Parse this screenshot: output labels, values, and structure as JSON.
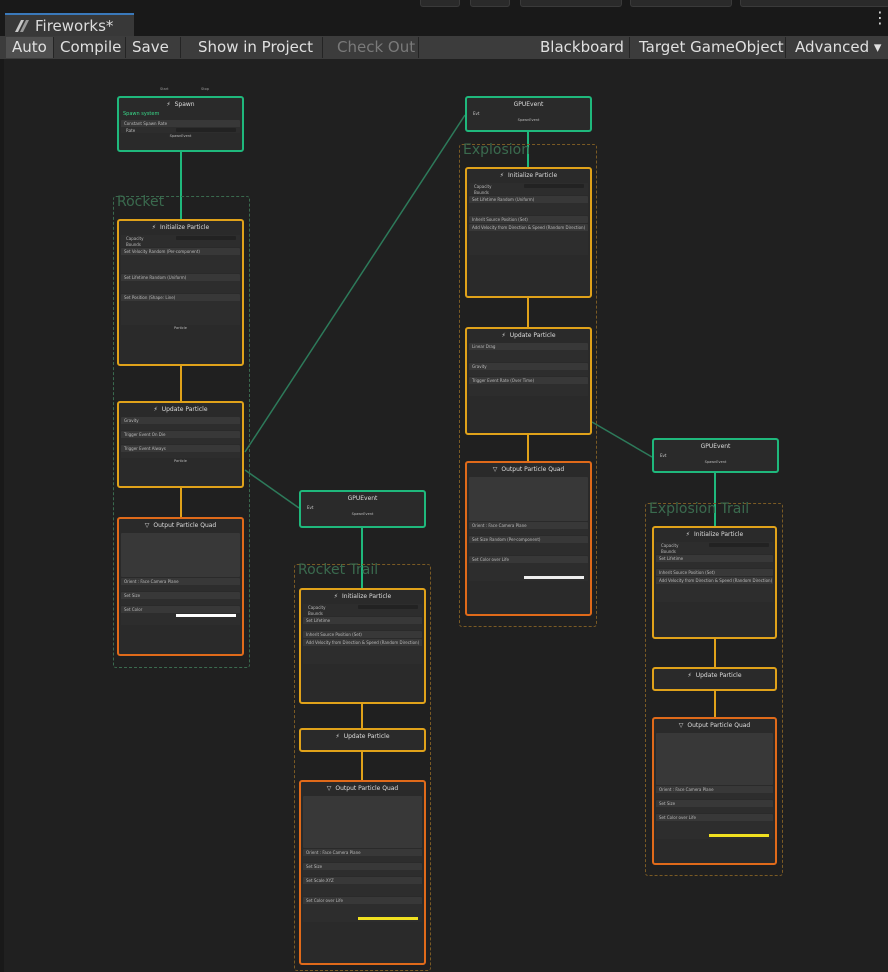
{
  "window": {
    "tab_title": "Fireworks*",
    "menu_icon": "kebab-menu-icon"
  },
  "toolbar": {
    "auto": "Auto",
    "compile": "Compile",
    "save": "Save",
    "show_in_project": "Show in Project",
    "check_out": "Check Out",
    "blackboard": "Blackboard",
    "target_gameobject": "Target GameObject",
    "advanced": "Advanced",
    "advanced_arrow": "▾"
  },
  "groups": {
    "rocket": "Rocket",
    "explosion": "Explosion",
    "rocket_trail": "Rocket Trail",
    "explosion_trail": "Explosion Trail"
  },
  "spawn": {
    "title": "Spawn",
    "subtitle": "Spawn system",
    "block": "Constant Spawn Rate",
    "field": "Rate",
    "out": "SpawnEvent",
    "ports": [
      "Start",
      "Stop"
    ]
  },
  "rocket": {
    "init_title": "Initialize Particle",
    "init_rows": [
      "Capacity",
      "Bounds",
      "Set Velocity Random (Per-component)",
      "Set Lifetime Random (Uniform)",
      "Set Position (Shape: Line)"
    ],
    "init_out": "Particle",
    "update_title": "Update Particle",
    "update_rows": [
      "Gravity",
      "Trigger Event On Die",
      "Trigger Event Always"
    ],
    "update_out": "Particle",
    "output_title": "Output Particle Quad",
    "output_rows": [
      "Orient : Face Camera Plane",
      "Set Size",
      "Set Color"
    ]
  },
  "gpuevent_nodes": [
    {
      "title": "GPUEvent",
      "in": "Evt",
      "out": "SpawnEvent"
    },
    {
      "title": "GPUEvent",
      "in": "Evt",
      "out": "SpawnEvent"
    },
    {
      "title": "GPUEvent",
      "in": "Evt",
      "out": "SpawnEvent"
    }
  ],
  "explosion": {
    "init_title": "Initialize Particle",
    "init_rows": [
      "Capacity",
      "Bounds",
      "Set Lifetime Random (Uniform)",
      "Inherit Source Position (Set)",
      "Add Velocity from Direction & Speed (Random Direction)"
    ],
    "update_title": "Update Particle",
    "update_rows": [
      "Linear Drag",
      "Gravity",
      "Trigger Event Rate (Over Time)"
    ],
    "output_title": "Output Particle Quad",
    "output_rows": [
      "Orient : Face Camera Plane",
      "Set Size Random (Per-component)",
      "Set Color over Life"
    ]
  },
  "rocket_trail": {
    "init_title": "Initialize Particle",
    "init_rows": [
      "Capacity",
      "Bounds",
      "Set Lifetime",
      "Inherit Source Position (Set)",
      "Add Velocity from Direction & Speed (Random Direction)"
    ],
    "update_title": "Update Particle",
    "update_rows": [],
    "output_title": "Output Particle Quad",
    "output_rows": [
      "Orient : Face Camera Plane",
      "Set Size",
      "Set Scale.XYZ",
      "Set Color over Life"
    ]
  },
  "explosion_trail": {
    "init_title": "Initialize Particle",
    "init_rows": [
      "Capacity",
      "Bounds",
      "Set Lifetime",
      "Inherit Source Position (Set)",
      "Add Velocity from Direction & Speed (Random Direction)"
    ],
    "update_title": "Update Particle",
    "update_rows": [],
    "output_title": "Output Particle Quad",
    "output_rows": [
      "Orient : Face Camera Plane",
      "Set Size",
      "Set Color over Life"
    ]
  },
  "colors": {
    "spawn_border": "#1fb87c",
    "init_border": "#e0a21a",
    "output_border": "#e06a1a",
    "group_rocket": "#3a6a4e",
    "group_explosion": "#7a5a24",
    "edge": "#2d7a5a"
  }
}
